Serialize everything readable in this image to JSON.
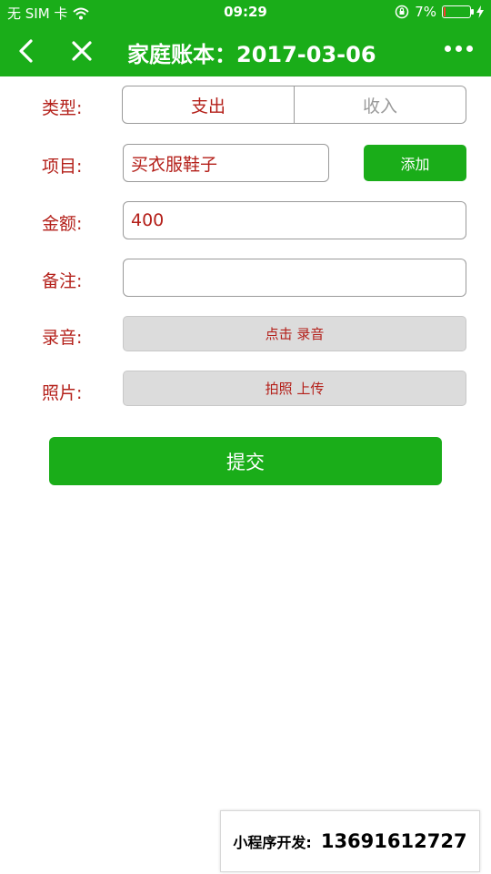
{
  "status_bar": {
    "carrier": "无 SIM 卡",
    "time": "09:29",
    "battery": "7%",
    "battery_level": 0.07,
    "battery_color": "#ff3b30"
  },
  "nav": {
    "title": "家庭账本：2017-03-06",
    "back_icon": "chevron-left-icon",
    "close_icon": "close-icon",
    "more_icon": "more-icon"
  },
  "form": {
    "type": {
      "label": "类型:",
      "options": [
        "支出",
        "收入"
      ],
      "selected": "支出"
    },
    "item": {
      "label": "项目:",
      "value": "买衣服鞋子",
      "add_button": "添加"
    },
    "amount": {
      "label": "金额:",
      "value": "400"
    },
    "note": {
      "label": "备注:",
      "value": ""
    },
    "audio": {
      "label": "录音:",
      "button": "点击 录音"
    },
    "photo": {
      "label": "照片:",
      "button": "拍照 上传"
    },
    "submit": "提交"
  },
  "watermark": {
    "label": "小程序开发:",
    "phone": "13691612727"
  },
  "colors": {
    "brand_green": "#1aad19",
    "label_red": "#b4201a"
  }
}
